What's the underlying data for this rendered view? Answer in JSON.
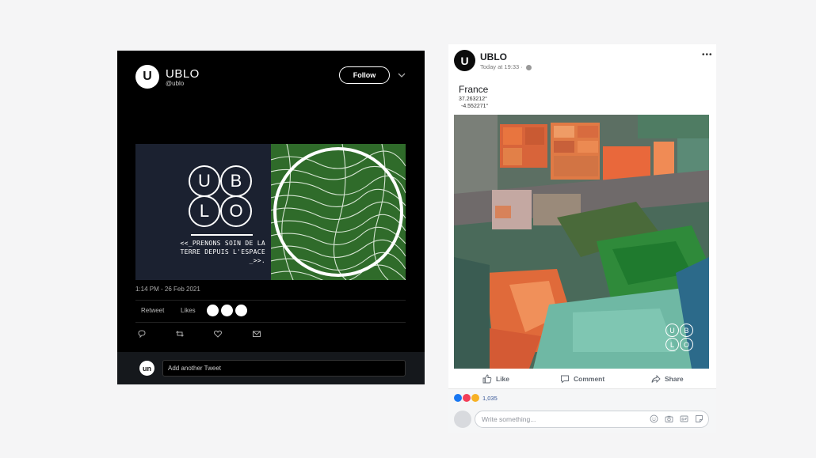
{
  "twitter": {
    "avatar_letter": "U",
    "name": "UBLO",
    "handle": "@ublo",
    "follow_label": "Follow",
    "media": {
      "logo_letters": [
        "U",
        "B",
        "L",
        "O"
      ],
      "tagline": "<<_PRENONS SOIN DE LA TERRE DEPUIS L'ESPACE _>>."
    },
    "date": "1:14 PM - 26 Feb 2021",
    "retweets_label": "Retweet",
    "likes_label": "Likes",
    "reply_avatar_text": "un",
    "reply_placeholder": "Add another Tweet",
    "icons": [
      "reply-icon",
      "retweet-icon",
      "like-icon",
      "dm-icon",
      "chevron-down-icon"
    ]
  },
  "facebook": {
    "avatar_letter": "U",
    "name": "UBLO",
    "timestamp": "Today at 19:33 ·",
    "more_label": "•••",
    "place": "France",
    "coord_lat": "37.263212°",
    "coord_lon": "-4.552271°",
    "logo_letters": [
      "U",
      "B",
      "L",
      "O"
    ],
    "like_label": "Like",
    "comment_label": "Comment",
    "share_label": "Share",
    "reaction_count": "1,035",
    "reaction_colors": [
      "#1877f2",
      "#f33e58",
      "#f7b125"
    ],
    "comment_placeholder": "Write something...",
    "icons": [
      "globe-icon",
      "like-icon",
      "comment-icon",
      "share-icon",
      "emoji-icon",
      "camera-icon",
      "gif-icon",
      "sticker-icon"
    ]
  }
}
